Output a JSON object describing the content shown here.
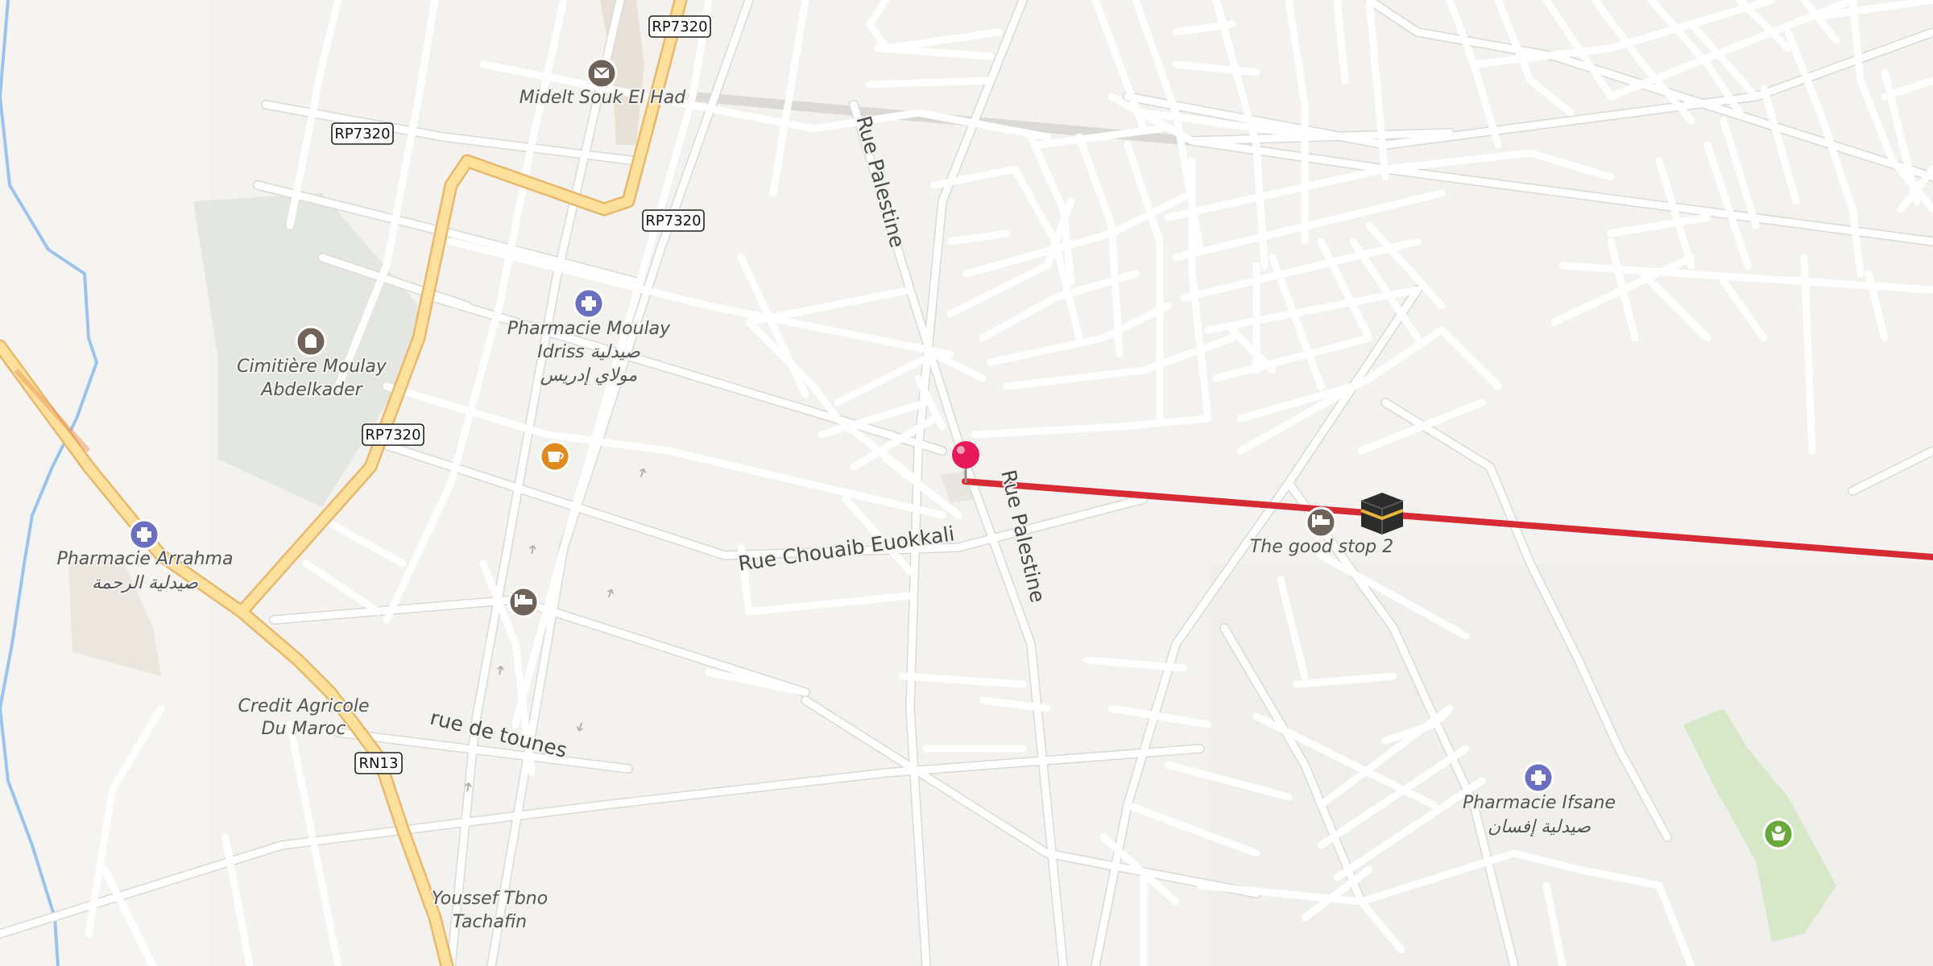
{
  "map": {
    "colors": {
      "background": "#f4f2ef",
      "road": "#ffffff",
      "major_road": "#fde09c",
      "river": "#9cc3ee",
      "cemetery": "#e4e7e1",
      "park": "#d6e8c8",
      "route_line": "#d62a35",
      "pin": "#e8195a",
      "poi_pharmacy": "#6b6fc2",
      "poi_cafe": "#e08a1e",
      "poi_generic": "#6e6259",
      "poi_park": "#6aa83c"
    },
    "shields": {
      "rp7320_top": "RP7320",
      "rp7320_left": "RP7320",
      "rp7320_mid": "RP7320",
      "rp7320_low": "RP7320",
      "rn13": "RN13"
    },
    "streets": {
      "rue_palestine_north": "Rue Palestine",
      "rue_palestine_south": "Rue Palestine",
      "rue_chouaib": "Rue Chouaib Euokkali",
      "rue_de_tounes": "rue de tounes"
    },
    "pois": {
      "midelt_souk": "Midelt Souk El Had",
      "pharmacie_moulay_l1": "Pharmacie Moulay",
      "pharmacie_moulay_l2": "Idriss صيدلية",
      "pharmacie_moulay_l3": "مولاي إدريس",
      "cemetery_l1": "Cimitière Moulay",
      "cemetery_l2": "Abdelkader",
      "pharmacie_arrahma_l1": "Pharmacie Arrahma",
      "pharmacie_arrahma_l2": "صيدلية الرحمة",
      "credit_agricole_l1": "Credit Agricole",
      "credit_agricole_l2": "Du Maroc",
      "youssef_l1": "Youssef Tbno",
      "youssef_l2": "Tachafin",
      "good_stop": "The good stop 2",
      "pharmacie_ifsane_l1": "Pharmacie Ifsane",
      "pharmacie_ifsane_l2": "صيدلية إفسان"
    },
    "icons": {
      "post": "envelope-icon",
      "pharmacy": "pharmacy-icon",
      "cemetery": "cemetery-icon",
      "cafe": "cafe-icon",
      "hotel": "bed-icon",
      "kaaba": "kaaba-icon",
      "park": "park-icon",
      "pin": "location-pin-icon"
    }
  }
}
